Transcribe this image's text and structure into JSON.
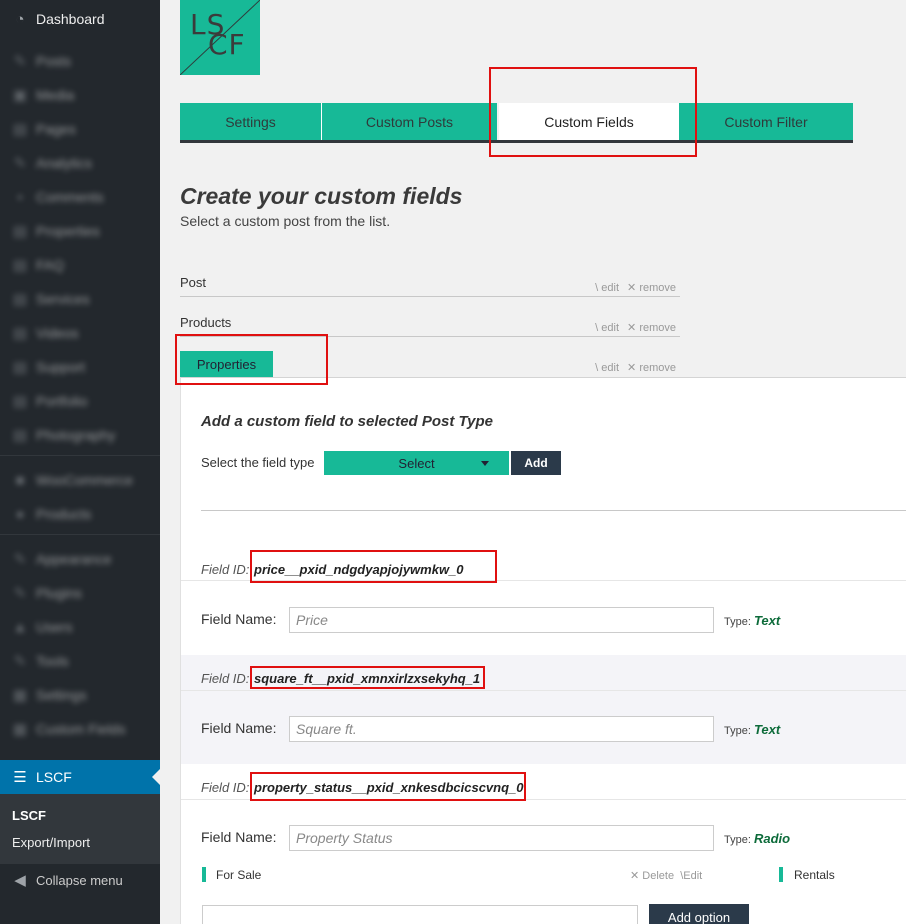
{
  "sidebar": {
    "dashboard": "Dashboard",
    "blurred_items": [
      "Posts",
      "Media",
      "Pages",
      "Analytics",
      "Comments",
      "Properties",
      "FAQ",
      "Services",
      "Videos",
      "Support",
      "Portfolio",
      "Photography",
      "WooCommerce",
      "Products",
      "Appearance",
      "Plugins",
      "Users",
      "Tools",
      "Settings",
      "Custom Fields"
    ],
    "active_item": "LSCF",
    "submenu": [
      "LSCF",
      "Export/Import"
    ],
    "collapse": "Collapse menu"
  },
  "logo": {
    "line1": "LS",
    "line2": "CF",
    "color": "#17b997"
  },
  "tabs": [
    "Settings",
    "Custom Posts",
    "Custom Fields",
    "Custom Filter"
  ],
  "active_tab": "Custom Fields",
  "heading": "Create your custom fields",
  "subheading": "Select a custom post from the list.",
  "posts": [
    {
      "name": "Post",
      "edit": "edit",
      "remove": "remove"
    },
    {
      "name": "Products",
      "edit": "edit",
      "remove": "remove"
    },
    {
      "name": "Properties",
      "edit": "edit",
      "remove": "remove",
      "selected": true
    }
  ],
  "panel": {
    "heading": "Add a custom field to selected Post Type",
    "field_type_label": "Select the field type",
    "select_value": "Select",
    "add_button": "Add"
  },
  "fields": [
    {
      "id_label": "Field ID:",
      "id": "price__pxid_ndgdyapjojywmkw_0",
      "name_label": "Field Name:",
      "placeholder": "Price",
      "type_label": "Type:",
      "type": "Text"
    },
    {
      "id_label": "Field ID:",
      "id": "square_ft__pxid_xmnxirlzxsekyhq_1",
      "name_label": "Field Name:",
      "placeholder": "Square ft.",
      "type_label": "Type:",
      "type": "Text"
    },
    {
      "id_label": "Field ID:",
      "id": "property_status__pxid_xnkesdbcicscvnq_0",
      "name_label": "Field Name:",
      "placeholder": "Property Status",
      "type_label": "Type:",
      "type": "Radio"
    }
  ],
  "options": {
    "items": [
      "For Sale",
      "Rentals"
    ],
    "delete": "Delete",
    "edit": "Edit",
    "add_option": "Add option"
  },
  "colors": {
    "accent": "#17b997",
    "sidebar": "#23282d",
    "active": "#0073aa",
    "highlight": "#e01010",
    "dark_button": "#2b3a4a"
  }
}
